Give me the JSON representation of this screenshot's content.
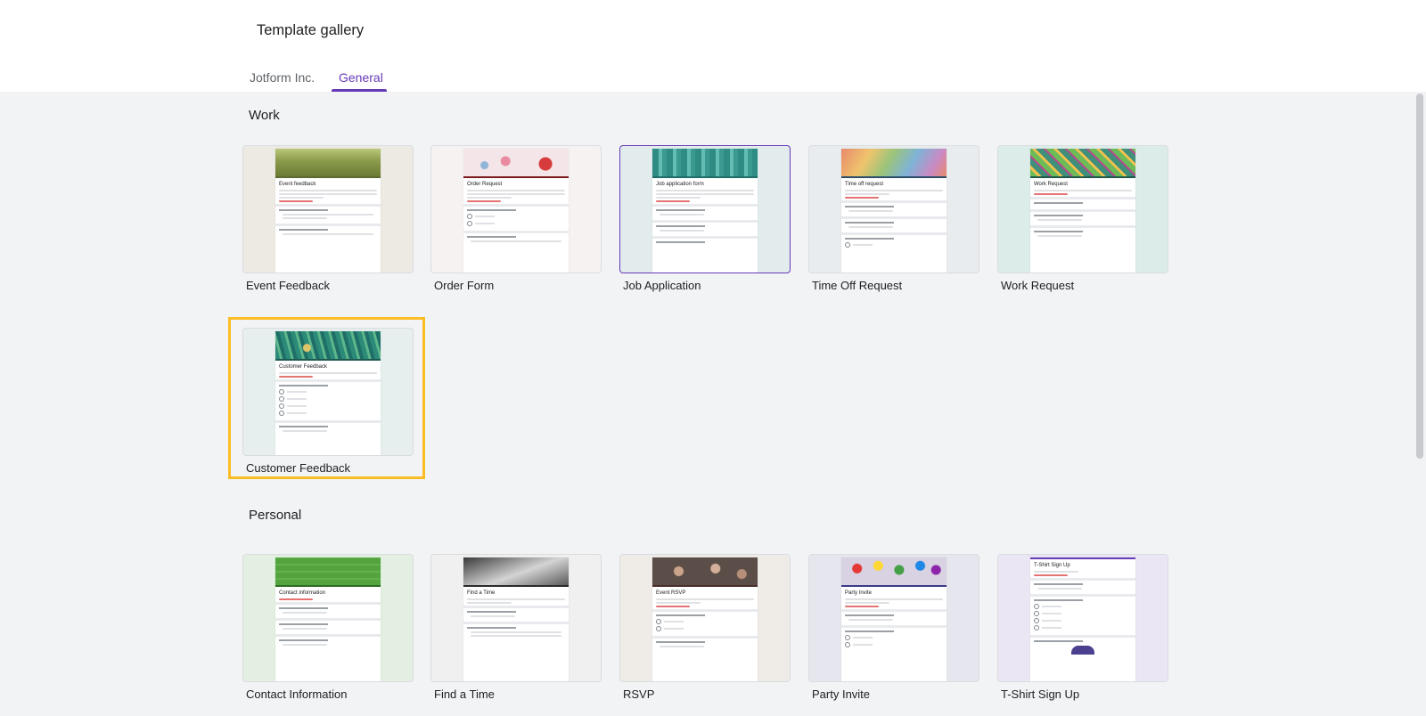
{
  "header": {
    "title": "Template gallery",
    "tabs": [
      {
        "label": "Jotform Inc.",
        "active": false
      },
      {
        "label": "General",
        "active": true
      }
    ]
  },
  "sections": [
    {
      "title": "Work",
      "templates": [
        {
          "label": "Event Feedback",
          "preview_title": "Event feedback",
          "thumb_bg": "#eceae3",
          "banner": "#8a9a4a",
          "accent": "#5d6b2f"
        },
        {
          "label": "Order Form",
          "preview_title": "Order Request",
          "thumb_bg": "#f6f2f2",
          "banner": "#f4e6e8",
          "accent": "#7b1a1a"
        },
        {
          "label": "Job Application",
          "preview_title": "Job application form",
          "thumb_bg": "#e2ecec",
          "banner": "#4fa9a3",
          "accent": "#1f6e68"
        },
        {
          "label": "Time Off Request",
          "preview_title": "Time off request",
          "thumb_bg": "#e9ecee",
          "banner": "#e9a76e",
          "accent": "#2a4d69"
        },
        {
          "label": "Work Request",
          "preview_title": "Work Request",
          "thumb_bg": "#dcece9",
          "banner": "#6dbb58",
          "accent": "#1e5a4c"
        },
        {
          "label": "Customer Feedback",
          "preview_title": "Customer Feedback",
          "thumb_bg": "#e6eeee",
          "banner": "#2b8a78",
          "accent": "#1d5b52"
        }
      ]
    },
    {
      "title": "Personal",
      "templates": [
        {
          "label": "Contact Information",
          "preview_title": "Contact information",
          "thumb_bg": "#e3efe0",
          "banner": "#53a33f",
          "accent": "#2e6b22"
        },
        {
          "label": "Find a Time",
          "preview_title": "Find a Time",
          "thumb_bg": "#f0f0f0",
          "banner": "#6e6e6e",
          "accent": "#2b2b2b"
        },
        {
          "label": "RSVP",
          "preview_title": "Event RSVP",
          "thumb_bg": "#efebe7",
          "banner": "#5b4e48",
          "accent": "#4a2d2a"
        },
        {
          "label": "Party Invite",
          "preview_title": "Party Invite",
          "thumb_bg": "#e6e6ee",
          "banner": "#c9b6d6",
          "accent": "#3a3a8a"
        },
        {
          "label": "T-Shirt Sign Up",
          "preview_title": "T-Shirt Sign Up",
          "thumb_bg": "#ebe6f3",
          "banner": "#ffffff",
          "accent": "#673ab7"
        }
      ]
    }
  ],
  "selected_template": "Job Application",
  "focused_template": "Customer Feedback",
  "colors": {
    "accent": "#673ab7",
    "focus_ring": "#fbbc24",
    "background": "#f1f3f4"
  }
}
